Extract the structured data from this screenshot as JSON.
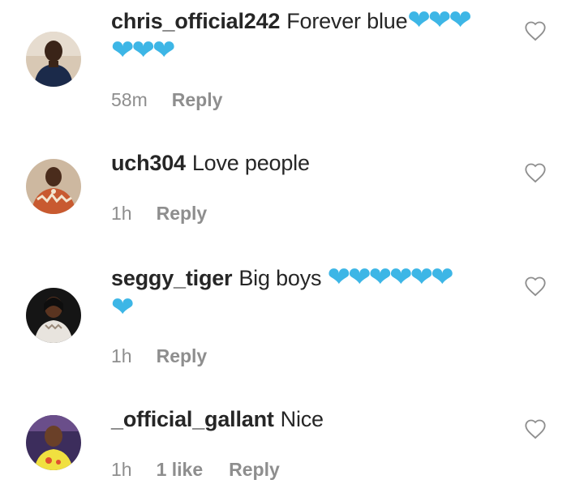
{
  "comments": [
    {
      "username": "chris_official242",
      "text": "Forever blue",
      "hearts_line1": "❤❤❤",
      "hearts_line2": "❤❤❤",
      "time": "58m",
      "likes": "",
      "reply_label": "Reply",
      "avatar_bg": "#b89a7a"
    },
    {
      "username": "uch304",
      "text": "Love people",
      "hearts_line1": "",
      "hearts_line2": "",
      "time": "1h",
      "likes": "",
      "reply_label": "Reply",
      "avatar_bg": "#c4a58a"
    },
    {
      "username": "seggy_tiger",
      "text": "Big boys",
      "hearts_line1": "❤❤❤❤❤❤",
      "hearts_line2": "❤",
      "time": "1h",
      "likes": "",
      "reply_label": "Reply",
      "avatar_bg": "#2a2a2a"
    },
    {
      "username": "_official_gallant",
      "text": "Nice",
      "hearts_line1": "",
      "hearts_line2": "",
      "time": "1h",
      "likes": "1 like",
      "reply_label": "Reply",
      "avatar_bg": "#4a3a6a"
    }
  ],
  "colors": {
    "heart_emoji": "#3db6e6",
    "meta_text": "#8e8e8e",
    "primary_text": "#262626"
  },
  "icons": {
    "like": "heart-outline-icon"
  }
}
